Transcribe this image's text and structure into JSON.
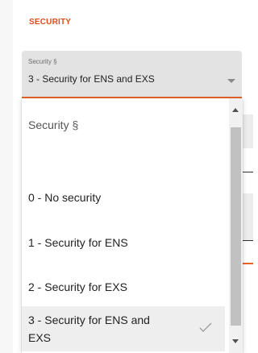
{
  "section": {
    "title": "SECURITY"
  },
  "select": {
    "label": "Security §",
    "value": "3 - Security for ENS and EXS"
  },
  "menu": {
    "items": [
      {
        "label": "Security §",
        "type": "header"
      },
      {
        "label": "",
        "type": "blank"
      },
      {
        "label": "0 - No security",
        "type": "option"
      },
      {
        "label": "1 - Security for ENS",
        "type": "option"
      },
      {
        "label": "2 - Security for EXS",
        "type": "option"
      },
      {
        "label": "3 - Security for ENS and EXS",
        "type": "option",
        "selected": true
      }
    ],
    "selected_icon": "check-icon"
  },
  "colors": {
    "accent": "#e8622b",
    "section_header": "#e34a1b",
    "field_background": "#e3e3e3",
    "selected_item_background": "#eeeeee"
  }
}
